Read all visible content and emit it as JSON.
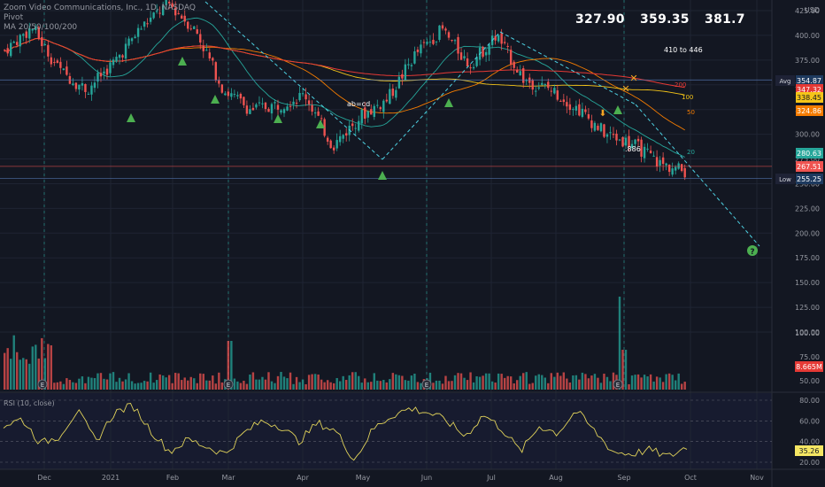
{
  "header": {
    "symbol_title": "Zoom Video Communications, Inc., 1D, NASDAQ",
    "line2": "Pivot",
    "line3": "MA 20/50/100/200"
  },
  "levels": {
    "a": "327.90",
    "b": "359.35",
    "c": "381.7"
  },
  "notes": {
    "target": "410 to 446",
    "abcd": "ab=cd",
    "fib": ".886",
    "question": "?"
  },
  "chart_data": [
    {
      "type": "candlestick",
      "title": "Zoom Video Communications, Inc., 1D, NASDAQ",
      "currency": "USD",
      "y_axis_ticks": [
        425,
        400,
        375,
        350,
        325,
        300,
        275,
        250,
        225,
        200,
        175,
        150,
        125,
        100
      ],
      "ylim": [
        100,
        430
      ],
      "x_axis_ticks": [
        "Dec",
        "2021",
        "Feb",
        "Mar",
        "Apr",
        "May",
        "Jun",
        "Jul",
        "Aug",
        "Sep",
        "Oct",
        "Nov"
      ],
      "price_path": [
        {
          "date": "Nov 16",
          "close": 385
        },
        {
          "date": "Dec 1",
          "close": 408
        },
        {
          "date": "Dec 15",
          "close": 365
        },
        {
          "date": "Jan 4",
          "close": 345
        },
        {
          "date": "Jan 20",
          "close": 373
        },
        {
          "date": "Feb 1",
          "close": 408
        },
        {
          "date": "Feb 12",
          "close": 432
        },
        {
          "date": "Feb 25",
          "close": 405
        },
        {
          "date": "Mar 4",
          "close": 345
        },
        {
          "date": "Mar 15",
          "close": 325
        },
        {
          "date": "Mar 31",
          "close": 330
        },
        {
          "date": "Apr 20",
          "close": 340
        },
        {
          "date": "May 11",
          "close": 288
        },
        {
          "date": "May 25",
          "close": 318
        },
        {
          "date": "Jun 15",
          "close": 335
        },
        {
          "date": "Jun 30",
          "close": 380
        },
        {
          "date": "Jul 8",
          "close": 406
        },
        {
          "date": "Jul 23",
          "close": 370
        },
        {
          "date": "Aug 3",
          "close": 400
        },
        {
          "date": "Aug 17",
          "close": 355
        },
        {
          "date": "Aug 26",
          "close": 345
        },
        {
          "date": "Aug 31",
          "close": 325
        },
        {
          "date": "Sep 3",
          "close": 300
        },
        {
          "date": "Sep 15",
          "close": 290
        },
        {
          "date": "Sep 24",
          "close": 270
        },
        {
          "date": "Sep 30",
          "close": 262
        }
      ],
      "price_labels": [
        {
          "label": "Avg",
          "value": "354.87",
          "color": "#1e3a5f"
        },
        {
          "label": "",
          "value": "347.32",
          "color": "#e53935"
        },
        {
          "label": "",
          "value": "338.45",
          "color": "#f5c518"
        },
        {
          "label": "",
          "value": "324.86",
          "color": "#f57c00"
        },
        {
          "label": "",
          "value": "280.63",
          "color": "#26a69a"
        },
        {
          "label": "",
          "value": "267.51",
          "color": "#ef5350"
        },
        {
          "label": "Low",
          "value": "255.25",
          "color": "#1e3a5f"
        }
      ],
      "ma_labels": [
        {
          "text": "200",
          "color": "#e53935"
        },
        {
          "text": "100",
          "color": "#f5c518"
        },
        {
          "text": "50",
          "color": "#f57c00"
        },
        {
          "text": "20",
          "color": "#26a69a"
        }
      ],
      "volume_label": "8.665M"
    },
    {
      "type": "line",
      "title": "RSI (10, close)",
      "y_axis_ticks": [
        80,
        60,
        40,
        20
      ],
      "ylim": [
        15,
        85
      ],
      "current": "35.26",
      "series": [
        {
          "values": [
            55,
            62,
            38,
            45,
            70,
            40,
            68,
            75,
            50,
            30,
            42,
            35,
            28,
            48,
            60,
            55,
            40,
            58,
            50,
            22,
            52,
            65,
            72,
            68,
            60,
            45,
            66,
            52,
            30,
            55,
            48,
            70,
            50,
            30,
            28,
            32,
            25,
            35
          ]
        }
      ]
    }
  ],
  "colors": {
    "bg": "#131722",
    "up": "#26a69a",
    "down": "#ef5350",
    "grid": "#1f2433",
    "text": "#9598a1"
  }
}
